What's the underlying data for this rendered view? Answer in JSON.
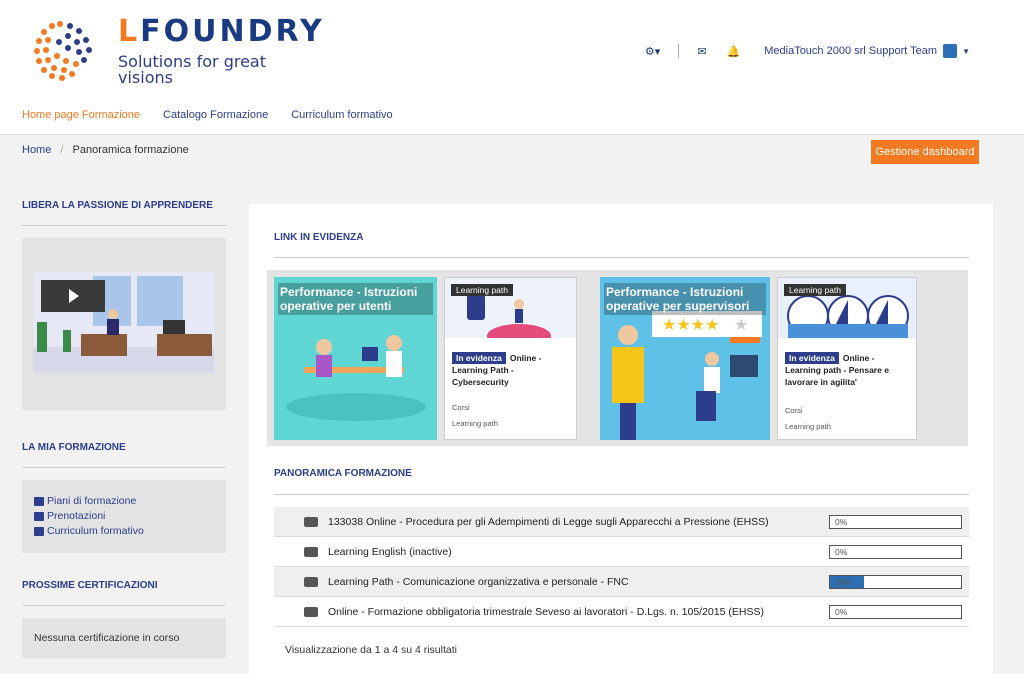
{
  "header": {
    "logo_word_first": "L",
    "logo_word_rest": "FOUNDRY",
    "tagline": "Solutions for great visions",
    "user_name": "MediaTouch 2000 srl Support Team",
    "icons": [
      "gear-icon",
      "envelope-icon",
      "bell-icon",
      "avatar-icon"
    ]
  },
  "nav": {
    "items": [
      "Home page Formazione",
      "Catalogo Formazione",
      "Curriculum formativo"
    ],
    "active": "Home page Formazione"
  },
  "breadcrumb": {
    "home": "Home",
    "current": "Panoramica formazione"
  },
  "buttons": {
    "gestione": "Gestione dashboard"
  },
  "sidebar": {
    "section1": "LIBERA LA PASSIONE DI APPRENDERE",
    "section2": "LA MIA FORMAZIONE",
    "links": [
      "Piani di formazione",
      "Prenotazioni",
      "Curriculum formativo"
    ],
    "section3": "PROSSIME CERTIFICAZIONI",
    "certifications_empty": "Nessuna certificazione in corso"
  },
  "main": {
    "links_title": "LINK IN EVIDENZA",
    "cards": [
      {
        "title": "Performance - Istruzioni operative per utenti"
      },
      {
        "tag": "Learning path",
        "badge": "In evidenza",
        "title": "Online - Learning Path - Cybersecurity",
        "meta1": "Corsi",
        "meta2": "Learning path"
      },
      {
        "title": "Performance - Istruzioni operative per supervisori"
      },
      {
        "tag": "Learning path",
        "badge": "In evidenza",
        "title": "Online - Learning path - Pensare e lavorare in agilita'",
        "meta1": "Corsi",
        "meta2": "Learning path"
      }
    ],
    "overview_title": "PANORAMICA FORMAZIONE",
    "rows": [
      {
        "name": "133038 Online - Procedura per gli Adempimenti di Legge sugli Apparecchi a Pressione (EHSS)",
        "progress": "0%",
        "value": 0
      },
      {
        "name": "Learning English (inactive)",
        "progress": "0%",
        "value": 0
      },
      {
        "name": "Learning Path - Comunicazione organizzativa e personale - FNC",
        "progress": "26%",
        "value": 26
      },
      {
        "name": "Online - Formazione obbligatoria trimestrale Seveso ai lavoratori - D.Lgs. n. 105/2015 (EHSS)",
        "progress": "0%",
        "value": 0
      }
    ],
    "results": "Visualizzazione da 1 a 4 su 4 risultati"
  },
  "colors": {
    "accent": "#f47920",
    "brand": "#2b3d8b",
    "progress": "#2d6fb4",
    "teal": "#5fd6d3"
  }
}
